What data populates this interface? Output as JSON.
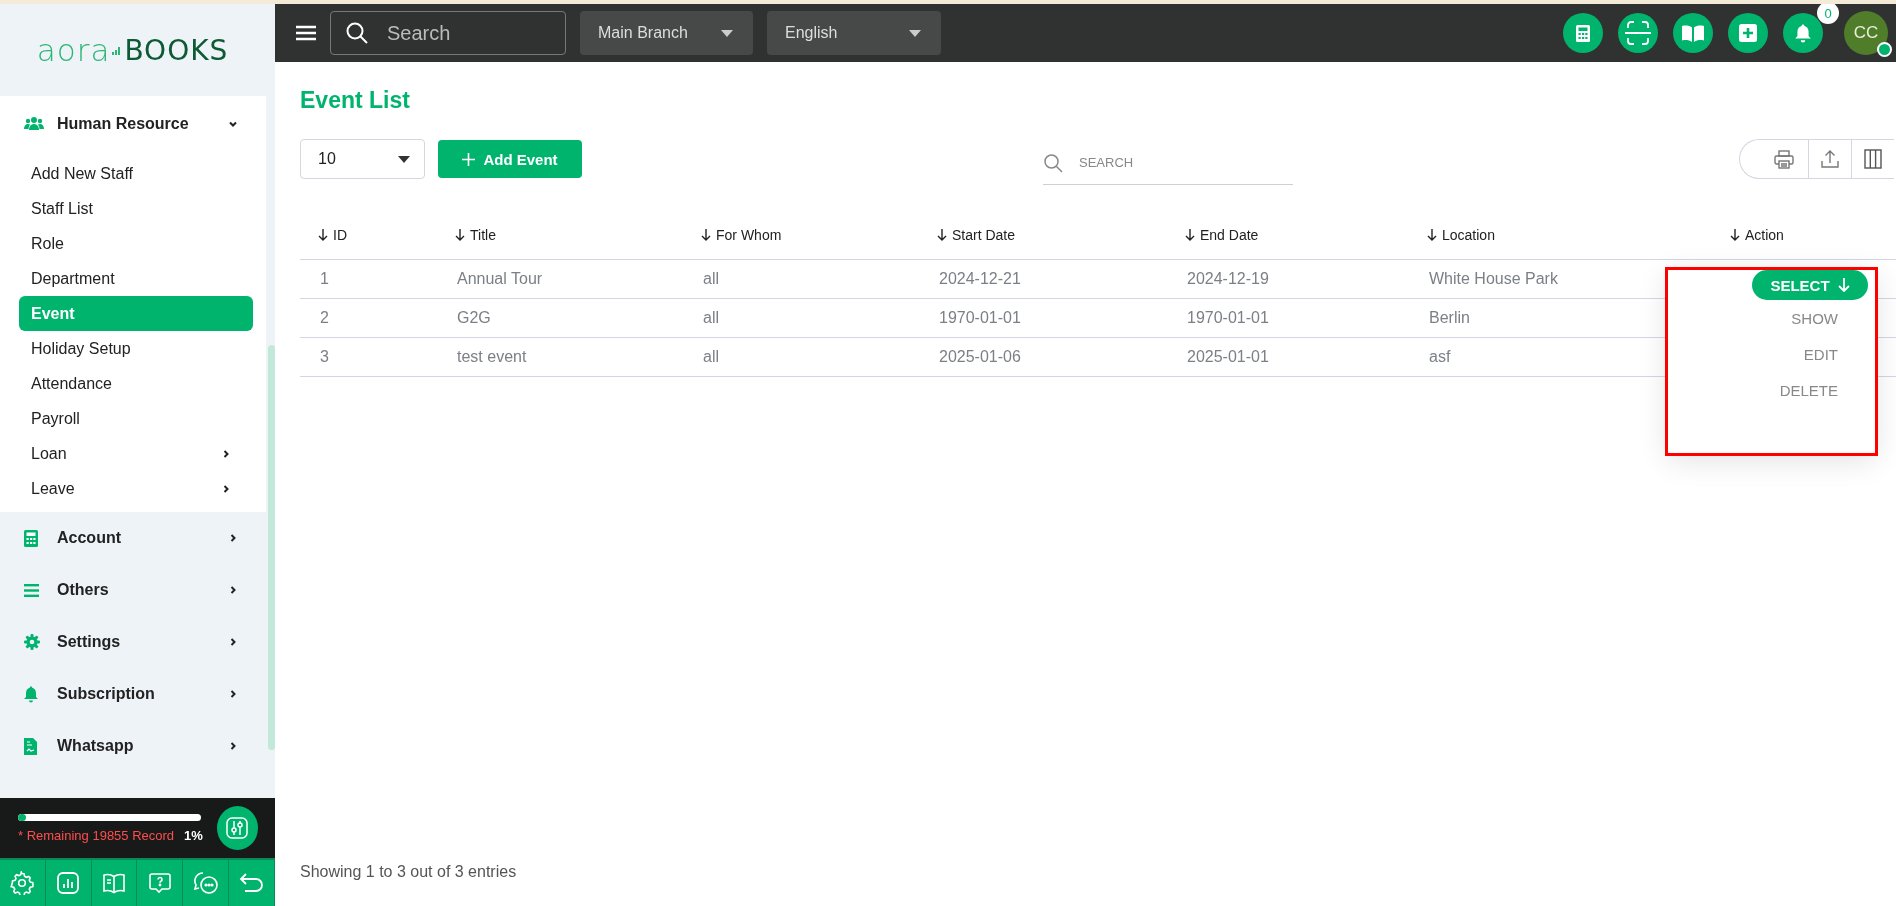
{
  "logo": {
    "left": "aora",
    "right": "BOOKS"
  },
  "topbar": {
    "search_placeholder": "Search",
    "branch": "Main Branch",
    "language": "English",
    "notifications": "0",
    "avatar": "CC",
    "online": true
  },
  "sidebar": {
    "groups": [
      {
        "label": "Human Resource",
        "expanded": true,
        "children": [
          {
            "label": "Add New Staff",
            "selected": false,
            "has_submenu": false
          },
          {
            "label": "Staff List",
            "selected": false,
            "has_submenu": false
          },
          {
            "label": "Role",
            "selected": false,
            "has_submenu": false
          },
          {
            "label": "Department",
            "selected": false,
            "has_submenu": false
          },
          {
            "label": "Event",
            "selected": true,
            "has_submenu": false
          },
          {
            "label": "Holiday Setup",
            "selected": false,
            "has_submenu": false
          },
          {
            "label": "Attendance",
            "selected": false,
            "has_submenu": false
          },
          {
            "label": "Payroll",
            "selected": false,
            "has_submenu": false
          },
          {
            "label": "Loan",
            "selected": false,
            "has_submenu": true
          },
          {
            "label": "Leave",
            "selected": false,
            "has_submenu": true
          }
        ]
      },
      {
        "label": "Account",
        "expanded": false
      },
      {
        "label": "Others",
        "expanded": false
      },
      {
        "label": "Settings",
        "expanded": false
      },
      {
        "label": "Subscription",
        "expanded": false
      },
      {
        "label": "Whatsapp",
        "expanded": false
      }
    ]
  },
  "usage": {
    "level": 0.01,
    "text": "* Remaining 19855 Record",
    "percent": "1%"
  },
  "page": {
    "title": "Event List",
    "page_size": "10",
    "add_button": "Add Event",
    "search_placeholder": "SEARCH"
  },
  "table": {
    "columns": [
      "ID",
      "Title",
      "For Whom",
      "Start Date",
      "End Date",
      "Location",
      "Action"
    ],
    "rows": [
      [
        "1",
        "Annual Tour",
        "all",
        "2024-12-21",
        "2024-12-19",
        "White House Park"
      ],
      [
        "2",
        "G2G",
        "all",
        "1970-01-01",
        "1970-01-01",
        "Berlin"
      ],
      [
        "3",
        "test event",
        "all",
        "2025-01-06",
        "2025-01-01",
        "asf"
      ]
    ]
  },
  "action_menu": {
    "button": "SELECT",
    "items": [
      "SHOW",
      "EDIT",
      "DELETE"
    ]
  },
  "footer": "Showing 1 to 3 out of 3 entries"
}
